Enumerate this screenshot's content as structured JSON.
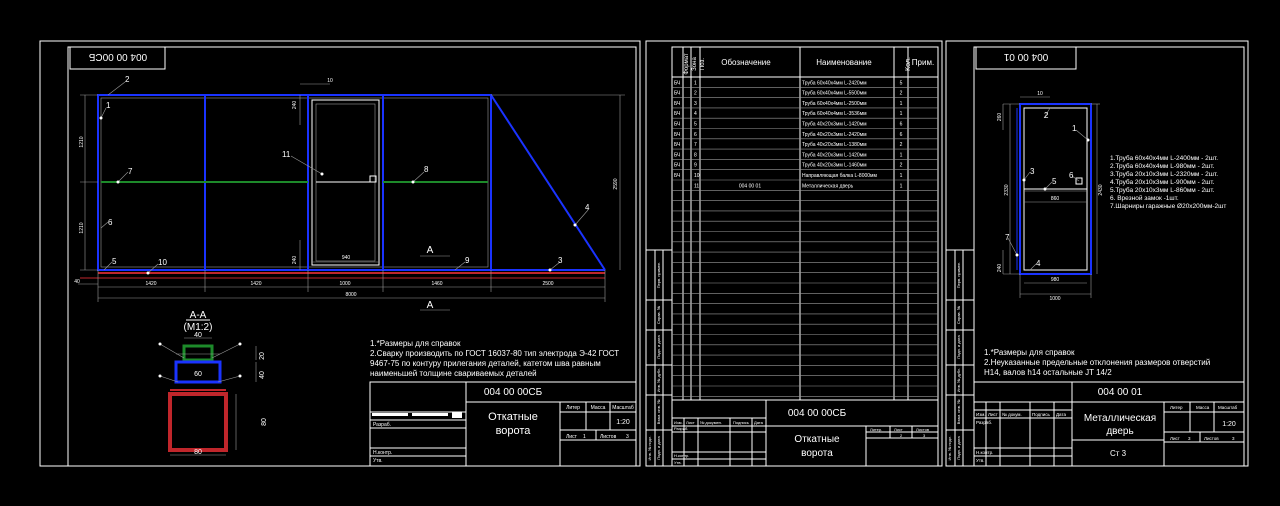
{
  "sheet1": {
    "stamp_mirror": "004 00 00СБ",
    "dims": [
      "1210",
      "1210",
      "240",
      "240",
      "10",
      "940",
      "2590",
      "1420",
      "1420",
      "1000",
      "1460",
      "2500",
      "8000",
      "40"
    ],
    "callouts": [
      "1",
      "2",
      "3",
      "4",
      "5",
      "6",
      "7",
      "8",
      "9",
      "10",
      "11"
    ],
    "section_letter": "А",
    "section_title": "А-А",
    "section_scale": "(М1:2)",
    "section_dims": [
      "40",
      "20",
      "60",
      "40",
      "80",
      "80"
    ],
    "notes": [
      "1.*Размеры для справок",
      "2.Сварку производить по ГОСТ 16037-80 тип электрода Э-42 ГОСТ",
      "9467-75 по контуру прилегания деталей, катетом шва равным",
      "наименьшей толщине свариваемых деталей"
    ],
    "titleblock": {
      "code": "004 00 00СБ",
      "name1": "Откатные",
      "name2": "ворота",
      "h_litera": "Литер",
      "h_massa": "Масса",
      "h_scale": "Масштаб",
      "scale": "1:20",
      "list": "Лист",
      "list_n": "1",
      "listov": "Листов",
      "listov_n": "3",
      "razrab": "Разраб.",
      "nkontr": "Н.контр.",
      "utv": "Утв."
    }
  },
  "sheet2": {
    "headers": [
      "Формат",
      "Зона",
      "Поз.",
      "Обозначение",
      "Наименование",
      "Кол.",
      "Прим."
    ],
    "rows": [
      {
        "fmt": "БЧ",
        "pos": "1",
        "des": "",
        "name": "Труба 60х40х4мм L-2420мм",
        "qty": "5"
      },
      {
        "fmt": "БЧ",
        "pos": "2",
        "des": "",
        "name": "Труба 60х40х4мм L-5500мм",
        "qty": "2"
      },
      {
        "fmt": "БЧ",
        "pos": "3",
        "des": "",
        "name": "Труба 60х40х4мм L-2500мм",
        "qty": "1"
      },
      {
        "fmt": "БЧ",
        "pos": "4",
        "des": "",
        "name": "Труба 60х40х4мм L-3536мм",
        "qty": "1"
      },
      {
        "fmt": "БЧ",
        "pos": "5",
        "des": "",
        "name": "Труба 40х20х3мм L-1420мм",
        "qty": "6"
      },
      {
        "fmt": "БЧ",
        "pos": "6",
        "des": "",
        "name": "Труба 40х20х3мм L-2420мм",
        "qty": "6"
      },
      {
        "fmt": "БЧ",
        "pos": "7",
        "des": "",
        "name": "Труба 40х20х3мм L-1380мм",
        "qty": "2"
      },
      {
        "fmt": "БЧ",
        "pos": "8",
        "des": "",
        "name": "Труба 40х20х3мм L-1420мм",
        "qty": "1"
      },
      {
        "fmt": "БЧ",
        "pos": "9",
        "des": "",
        "name": "Труба 40х20х3мм L-1460мм",
        "qty": "2"
      },
      {
        "fmt": "БЧ",
        "pos": "10",
        "des": "",
        "name": "Направляющая балка L-8000мм",
        "qty": "1"
      },
      {
        "fmt": "",
        "pos": "11",
        "des": "004 00 01",
        "name": "Металлическая дверь",
        "qty": "1"
      }
    ],
    "side_labels": [
      "Перв. примен.",
      "Справ. №",
      "Подп. и дата",
      "Инв. № дубл.",
      "Взам. инв. №",
      "Подп. и дата",
      "Инв. № подл."
    ],
    "titleblock": {
      "code": "004 00 00СБ",
      "name1": "Откатные",
      "name2": "ворота",
      "h_izm": "Изм.",
      "h_list": "Лист",
      "h_doc": "№ докумен.",
      "h_podp": "Подпись",
      "h_data": "Дата",
      "h_litera": "Литер.",
      "h_lst": "Лист",
      "h_listov": "Листов",
      "list_n": "2",
      "listov_n": "3",
      "razrab": "Разраб.",
      "nkontr": "Н.контр.",
      "utv": "Утв."
    }
  },
  "sheet3": {
    "stamp_mirror": "004 00 01",
    "dims": [
      "10",
      "260",
      "2330",
      "2430",
      "860",
      "240",
      "980",
      "1000"
    ],
    "callouts": [
      "1",
      "2",
      "3",
      "4",
      "5",
      "6",
      "7"
    ],
    "parts": [
      "1.Труба 60х40х4мм L-2400мм - 2шт.",
      "2.Труба 60х40х4мм L-980мм  - 2шт.",
      "3.Труба 20х10х3мм L-2320мм - 2шт.",
      "4.Труба 20х10х3мм L-900мм  - 2шт.",
      "5.Труба 20х10х3мм L-860мм  - 2шт.",
      "6. Врезной замок              -1шт.",
      "7.Шарниры гаражные Ø20х200мм-2шт"
    ],
    "notes": [
      "1.*Размеры для справок",
      "2.Неуказанные предельные отклонения размеров отверстий",
      "Н14, валов h14 остальные JT 14/2"
    ],
    "titleblock": {
      "code": "004 00 01",
      "name1": "Металлическая",
      "name2": "дверь",
      "material": "Ст 3",
      "h_izm": "Изм.",
      "h_list": "Лист",
      "h_doc": "№ докум.",
      "h_podp": "Подпись",
      "h_data": "Дата",
      "h_litera": "Литер",
      "h_massa": "Масса",
      "h_scale": "Масштаб",
      "scale": "1:20",
      "list": "Лист",
      "list_n": "3",
      "listov": "Листов",
      "listov_n": "3",
      "razrab": "Разраб.",
      "nkontr": "Н.контр.",
      "utv": "Утв."
    }
  },
  "colors": {
    "frame": "#ffffff",
    "profile": "#1a33ff",
    "crossbar": "#1d8a2a",
    "rail": "#c0262b",
    "grid": "#9a9a9a"
  }
}
